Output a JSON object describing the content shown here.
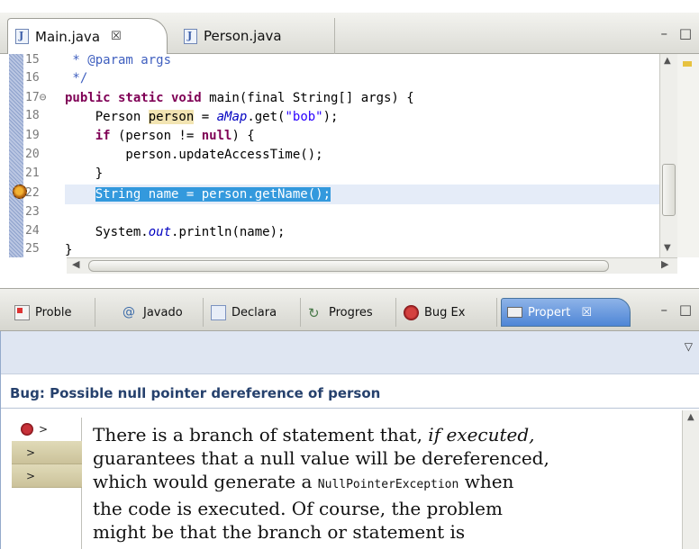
{
  "editor": {
    "tabs": [
      {
        "label": "Main.java",
        "close": "☒",
        "active": true
      },
      {
        "label": "Person.java",
        "active": false
      }
    ],
    "window_buttons": "– □",
    "line_numbers": [
      "15",
      "16",
      "17⊖",
      "18",
      "19",
      "20",
      "21",
      "22",
      "23",
      "24",
      "25"
    ],
    "code": {
      "l15": " * @param args",
      "l16": " */",
      "l17_kw": "public static void",
      "l17_rest": " main(final String[] args) {",
      "l18_a": "    Person ",
      "l18_var": "person",
      "l18_b": " = ",
      "l18_field": "aMap",
      "l18_c": ".get(",
      "l18_str": "\"bob\"",
      "l18_d": ");",
      "l19_a": "    ",
      "l19_kw": "if",
      "l19_b": " (person != ",
      "l19_kw2": "null",
      "l19_c": ") {",
      "l20": "        person.updateAccessTime();",
      "l21": "    }",
      "l22_a": "    ",
      "l22_sel": "String name = person.getName();",
      "l24_a": "    System.",
      "l24_field": "out",
      "l24_b": ".println(name);",
      "l25": "}"
    }
  },
  "views": {
    "tabs": [
      {
        "label": "Proble",
        "icon": "problems-icon"
      },
      {
        "label": "Javado",
        "icon": "javadoc-icon"
      },
      {
        "label": "Declara",
        "icon": "declaration-icon"
      },
      {
        "label": "Progres",
        "icon": "progress-icon"
      },
      {
        "label": "Bug Ex",
        "icon": "bug-explorer-icon"
      },
      {
        "label": "Propert",
        "icon": "properties-icon",
        "active": true
      }
    ],
    "close": "☒",
    "window_buttons": "– □"
  },
  "properties": {
    "view_menu": "▽",
    "bug_title": "Bug: Possible null pointer dereference of person",
    "tree_rows": [
      ">",
      ">",
      ">"
    ],
    "description": {
      "p1": "There is a branch of statement that, ",
      "p1_em": "if executed,",
      "p2": "guarantees that a null value will be dereferenced,",
      "p3_a": "which would generate a ",
      "p3_mono": "NullPointerException",
      "p3_b": " when",
      "p4": "the code is executed. Of course, the problem",
      "p5": "might be that the branch or statement is"
    }
  },
  "colors": {
    "keyword": "#7f0055",
    "string": "#2a00ff",
    "selection": "#3399dd",
    "active_view_tab": "#4f86d6",
    "bug_title": "#26416d"
  }
}
